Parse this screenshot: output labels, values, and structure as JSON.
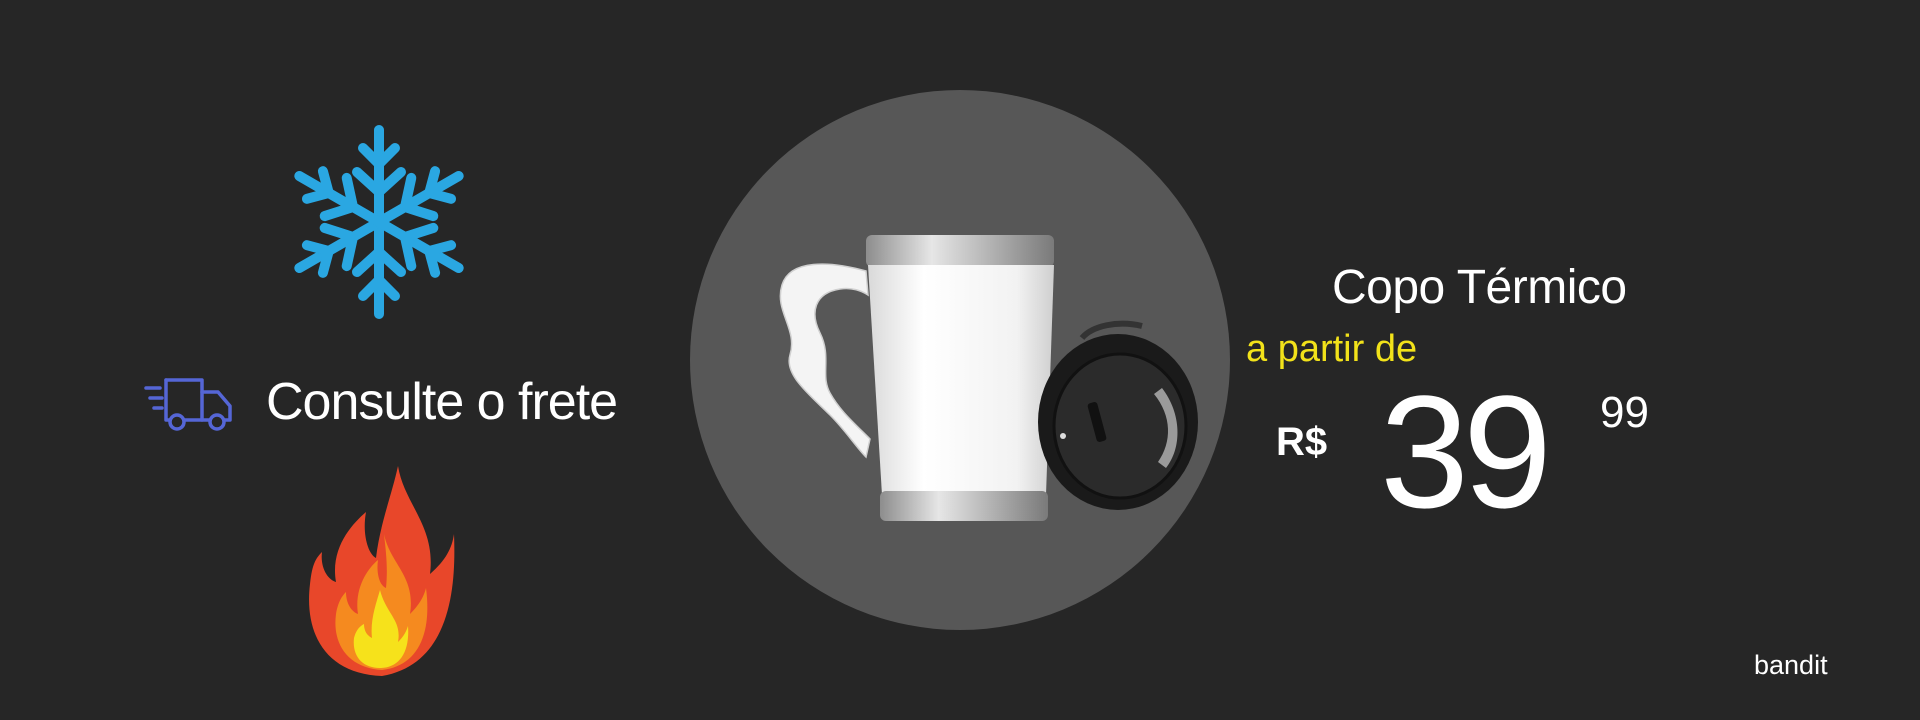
{
  "icons": {
    "cold": "snowflake-icon",
    "shipping": "delivery-truck-icon",
    "hot": "fire-icon"
  },
  "shipping": {
    "label": "Consulte o frete"
  },
  "product": {
    "name": "Copo Térmico",
    "image": "thermal-mug-with-lid"
  },
  "price": {
    "prefix": "a partir de",
    "currency": "R$",
    "integer": "39",
    "cents": "99"
  },
  "brand": {
    "name": "bandit"
  },
  "colors": {
    "background": "#262626",
    "circle": "#575757",
    "snowflake": "#2aa7e2",
    "truck": "#5566d6",
    "accent_yellow": "#f2e21a",
    "text": "#ffffff"
  }
}
